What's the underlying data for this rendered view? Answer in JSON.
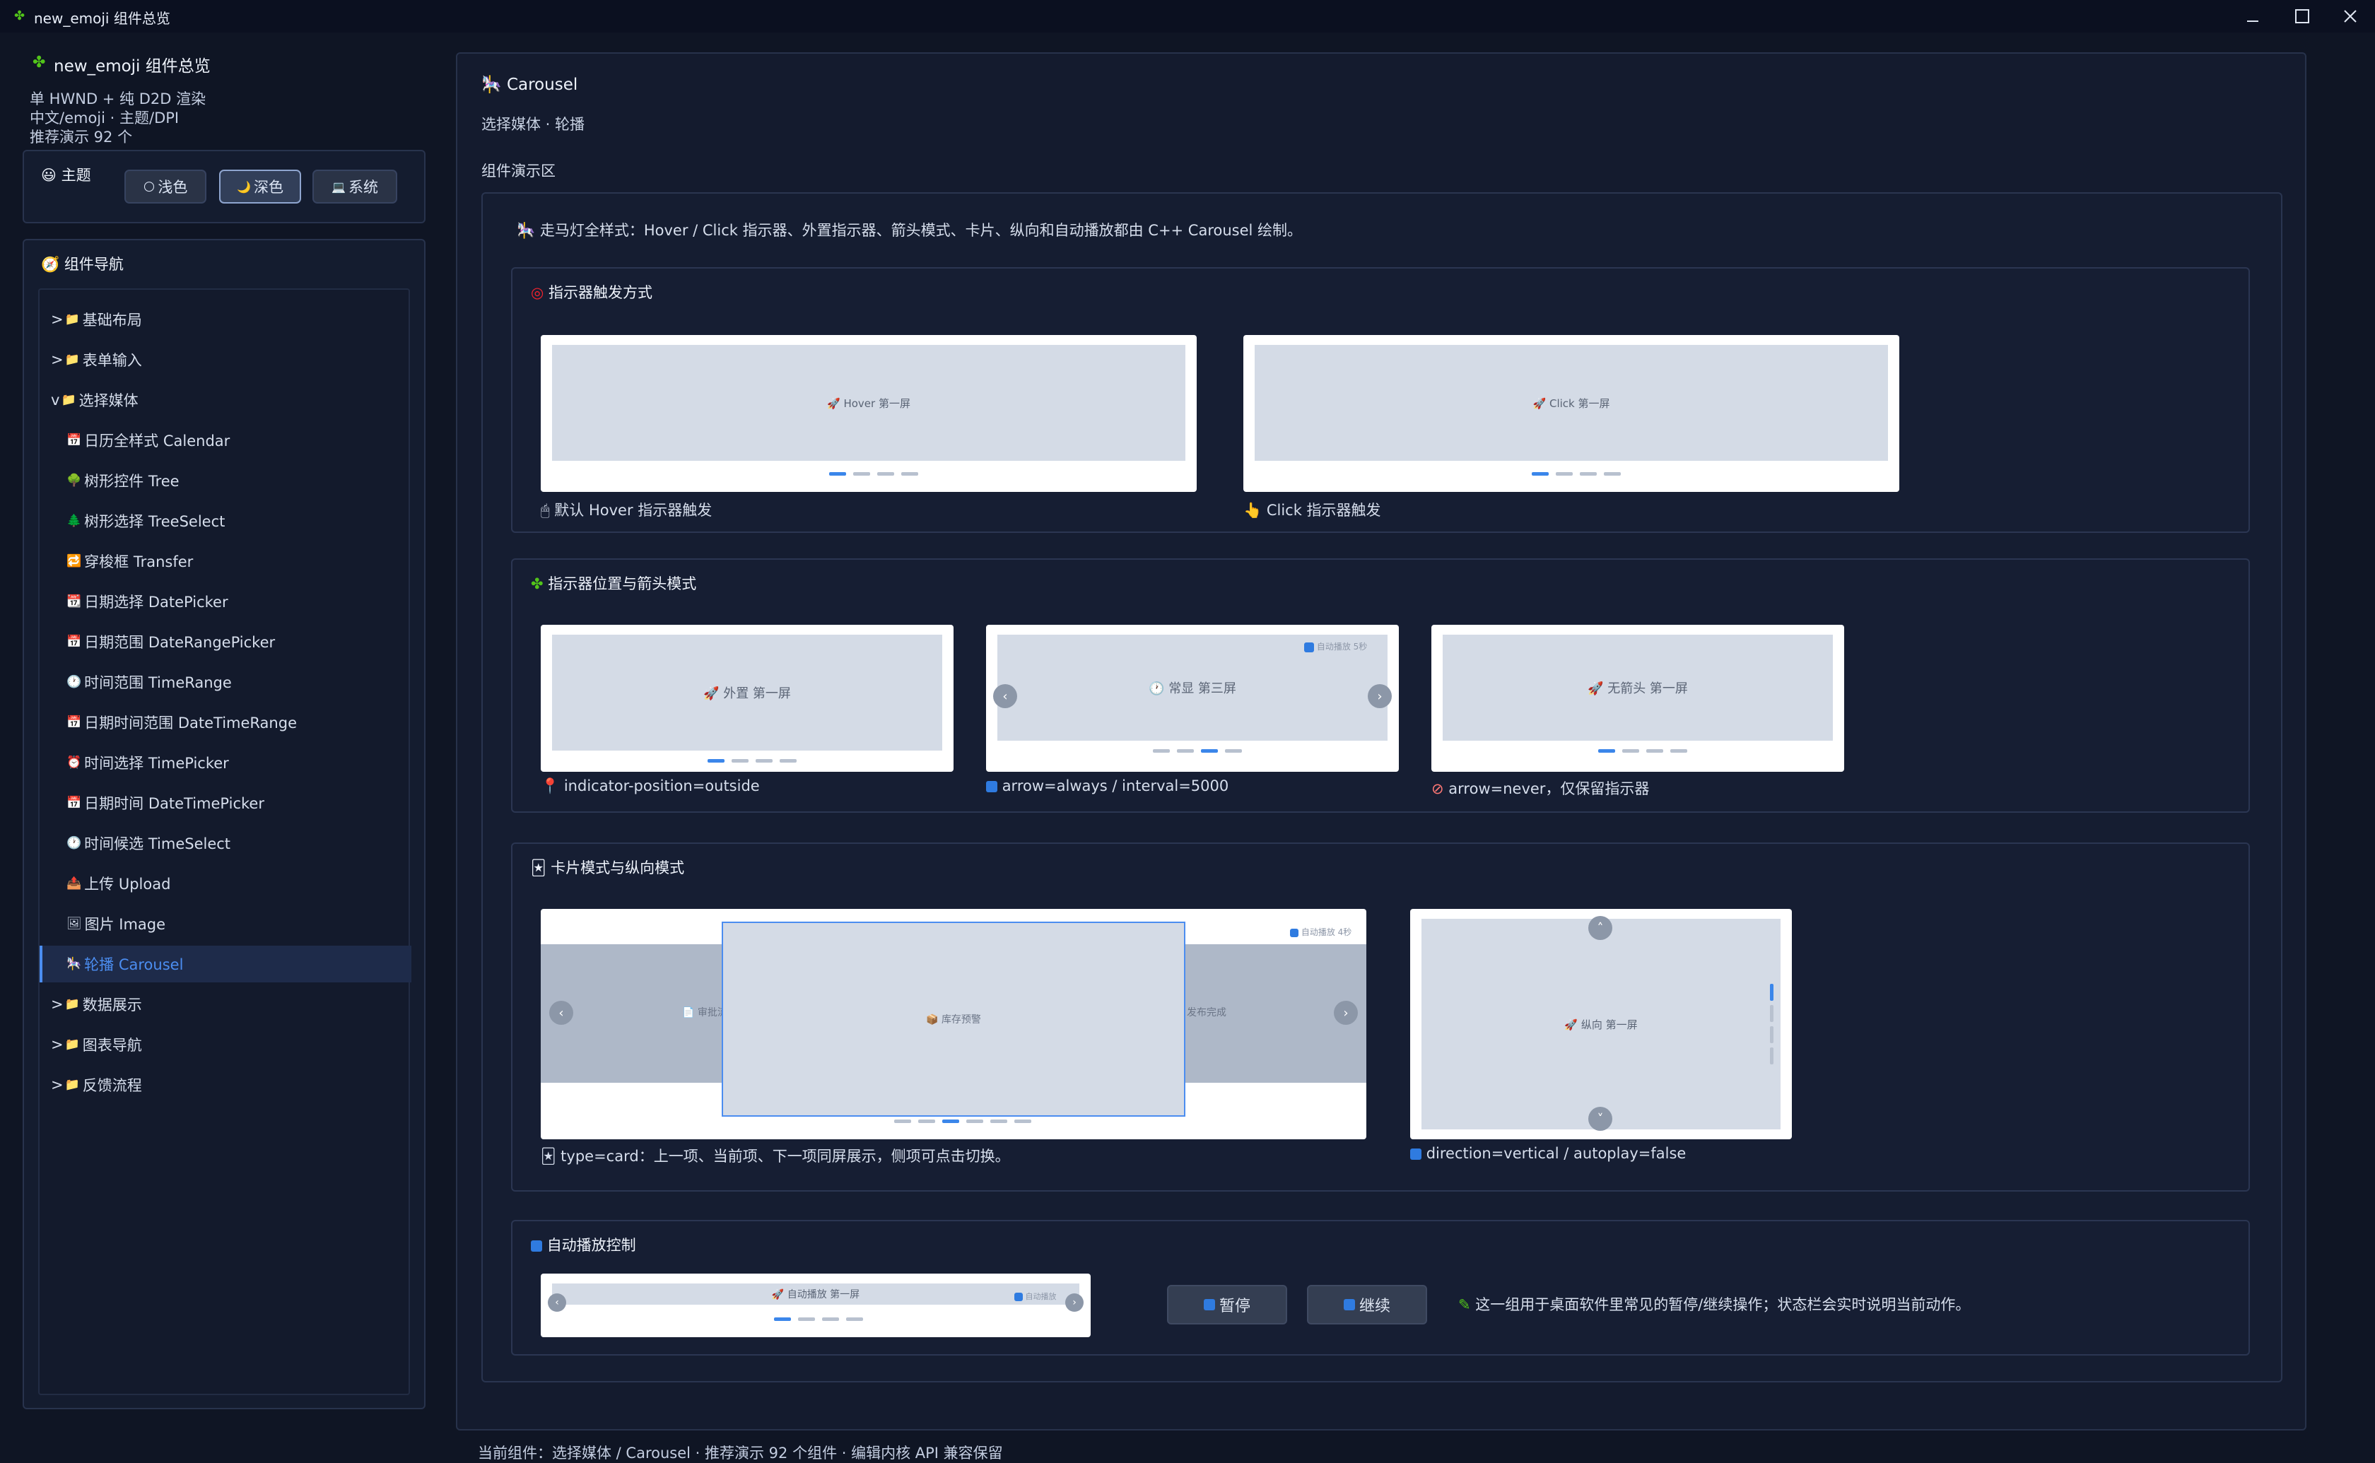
{
  "window": {
    "title": "new_emoji 组件总览"
  },
  "sidebar": {
    "app_title": "new_emoji 组件总览",
    "info_lines": [
      "单 HWND + 纯 D2D 渲染",
      "中文/emoji · 主题/DPI",
      "推荐演示 92 个"
    ],
    "theme": {
      "header": "主题",
      "buttons": [
        {
          "icon": "🌕",
          "label": "浅色"
        },
        {
          "icon": "🌙",
          "label": "深色"
        },
        {
          "icon": "💻",
          "label": "系统"
        }
      ],
      "selected": "深色"
    },
    "nav": {
      "header": "组件导航",
      "items": [
        {
          "prefix": ">",
          "icon": "📁",
          "label": "基础布局"
        },
        {
          "prefix": ">",
          "icon": "📁",
          "label": "表单输入"
        },
        {
          "prefix": "v",
          "icon": "📁",
          "label": "选择媒体"
        },
        {
          "prefix": "",
          "icon": "📅",
          "label": "日历全样式 Calendar"
        },
        {
          "prefix": "",
          "icon": "🌳",
          "label": "树形控件 Tree"
        },
        {
          "prefix": "",
          "icon": "🌲",
          "label": "树形选择 TreeSelect"
        },
        {
          "prefix": "",
          "icon": "🔁",
          "label": "穿梭框 Transfer"
        },
        {
          "prefix": "",
          "icon": "📆",
          "label": "日期选择 DatePicker"
        },
        {
          "prefix": "",
          "icon": "📅",
          "label": "日期范围 DateRangePicker"
        },
        {
          "prefix": "",
          "icon": "🕐",
          "label": "时间范围 TimeRange"
        },
        {
          "prefix": "",
          "icon": "📅",
          "label": "日期时间范围 DateTimeRange"
        },
        {
          "prefix": "",
          "icon": "⏰",
          "label": "时间选择 TimePicker"
        },
        {
          "prefix": "",
          "icon": "📅",
          "label": "日期时间 DateTimePicker"
        },
        {
          "prefix": "",
          "icon": "🕐",
          "label": "时间候选 TimeSelect"
        },
        {
          "prefix": "",
          "icon": "📤",
          "label": "上传 Upload"
        },
        {
          "prefix": "",
          "icon": "🖼",
          "label": "图片 Image"
        },
        {
          "prefix": "",
          "icon": "🎠",
          "label": "轮播 Carousel",
          "active": true
        },
        {
          "prefix": ">",
          "icon": "📁",
          "label": "数据展示"
        },
        {
          "prefix": ">",
          "icon": "📁",
          "label": "图表导航"
        },
        {
          "prefix": ">",
          "icon": "📁",
          "label": "反馈流程"
        }
      ]
    }
  },
  "main": {
    "title": "Carousel",
    "subtitle": "选择媒体 · 轮播",
    "demo_label": "组件演示区",
    "intro": "走马灯全样式：Hover / Click 指示器、外置指示器、箭头模式、卡片、纵向和自动播放都由 C++ Carousel 绘制。",
    "sections": {
      "trigger": {
        "title": "指示器触发方式",
        "demos": [
          {
            "slide": "Hover 第一屏",
            "caption": "默认 Hover 指示器触发"
          },
          {
            "slide": "Click 第一屏",
            "caption": "Click 指示器触发"
          }
        ]
      },
      "position": {
        "title": "指示器位置与箭头模式",
        "demos": [
          {
            "slide": "外置 第一屏",
            "caption": "indicator-position=outside"
          },
          {
            "slide": "常显 第三屏",
            "badge": "自动播放 5秒",
            "caption": "arrow=always / interval=5000"
          },
          {
            "slide": "无箭头 第一屏",
            "caption": "arrow=never，仅保留指示器"
          }
        ]
      },
      "card": {
        "title": "卡片模式与纵向模式",
        "card_demo": {
          "prev": "审批流",
          "center": "库存预警",
          "next": "发布完成",
          "badge": "自动播放 4秒",
          "caption": "type=card：上一项、当前项、下一项同屏展示，侧项可点击切换。"
        },
        "vertical_demo": {
          "slide": "纵向 第一屏",
          "caption": "direction=vertical / autoplay=false"
        }
      },
      "autoplay": {
        "title": "自动播放控制",
        "slide": "自动播放 第一屏",
        "badge": "自动播放",
        "pause_label": "暂停",
        "resume_label": "继续",
        "note": "这一组用于桌面软件里常见的暂停/继续操作；状态栏会实时说明当前动作。"
      }
    }
  },
  "status_bar": "当前组件：选择媒体 / Carousel · 推荐演示 92 个组件 · 编辑内核 API 兼容保留",
  "colors": {
    "background": "#0f1524",
    "accent": "#3b86ea",
    "panel": "#141b2e"
  }
}
